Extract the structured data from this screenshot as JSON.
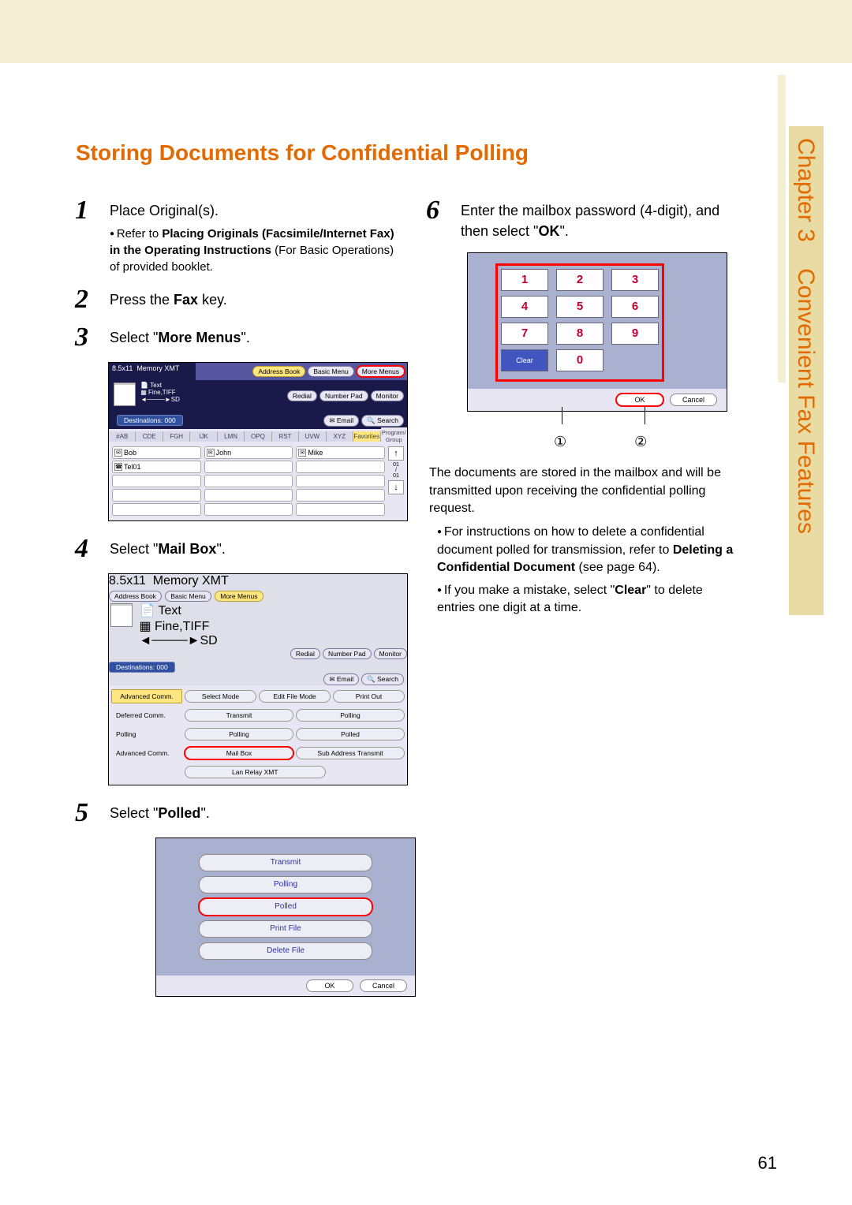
{
  "chapter": {
    "word": "Chapter",
    "num": "3",
    "title": "Convenient Fax Features"
  },
  "heading": "Storing Documents for Confidential Polling",
  "steps": {
    "s1": {
      "num": "1",
      "text": "Place Original(s).",
      "bullet_pre": "Refer to ",
      "bullet_b": "Placing Originals (Facsimile/Internet Fax) in the Operating Instructions",
      "bullet_post": " (For Basic Operations) of provided booklet."
    },
    "s2": {
      "num": "2",
      "pre": "Press the ",
      "b": "Fax",
      "post": " key."
    },
    "s3": {
      "num": "3",
      "pre": "Select \"",
      "b": "More Menus",
      "post": "\"."
    },
    "s4": {
      "num": "4",
      "pre": "Select \"",
      "b": "Mail Box",
      "post": "\"."
    },
    "s5": {
      "num": "5",
      "pre": "Select \"",
      "b": "Polled",
      "post": "\"."
    },
    "s6": {
      "num": "6",
      "pre": "Enter the mailbox password (4-digit), and then select \"",
      "b": "OK",
      "post": "\"."
    }
  },
  "ss1": {
    "size": "8.5x11",
    "mem": "Memory XMT",
    "text": "Text",
    "fine": "Fine,TIFF",
    "sd": "SD",
    "addr": "Address Book",
    "basic": "Basic Menu",
    "more": "More Menus",
    "redial": "Redial",
    "numpad": "Number Pad",
    "monitor": "Monitor",
    "dest": "Destinations: 000",
    "email": "Email",
    "search": "Search",
    "tabs": [
      "#AB",
      "CDE",
      "FGH",
      "IJK",
      "LMN",
      "OPQ",
      "RST",
      "UVW",
      "XYZ",
      "Favorites",
      "Program/\nGroup"
    ],
    "c": {
      "bob": "Bob",
      "john": "John",
      "mike": "Mike",
      "tel": "Tel01"
    },
    "scroll": "01\n/\n01"
  },
  "ss2": {
    "row_labels": [
      "Advanced Comm.",
      "Deferred Comm.",
      "Polling",
      "Advanced Comm."
    ],
    "r1": [
      "Select Mode",
      "Edit File Mode",
      "Print Out"
    ],
    "r2": [
      "Transmit",
      "Polling"
    ],
    "r3": [
      "Polling",
      "Polled"
    ],
    "r4": [
      "Mail Box",
      "Sub Address Transmit"
    ],
    "r5": "Lan Relay XMT"
  },
  "ss3": {
    "btns": [
      "Transmit",
      "Polling",
      "Polled",
      "Print File",
      "Delete File"
    ],
    "ok": "OK",
    "cancel": "Cancel"
  },
  "ss4": {
    "keys": [
      [
        "1",
        "2",
        "3"
      ],
      [
        "4",
        "5",
        "6"
      ],
      [
        "7",
        "8",
        "9"
      ]
    ],
    "clear": "Clear",
    "zero": "0",
    "ok": "OK",
    "cancel": "Cancel",
    "callout1": "①",
    "callout2": "②"
  },
  "after6": {
    "para": "The documents are stored in the mailbox and will be transmitted upon receiving the confidential polling request.",
    "b1_pre": "For instructions on how to delete a confidential document polled for transmission, refer to ",
    "b1_b": "Deleting a Confidential Document",
    "b1_post": " (see page 64).",
    "b2_pre": "If you make a mistake, select \"",
    "b2_b": "Clear",
    "b2_post": "\" to delete entries one digit at a time."
  },
  "page_number": "61"
}
